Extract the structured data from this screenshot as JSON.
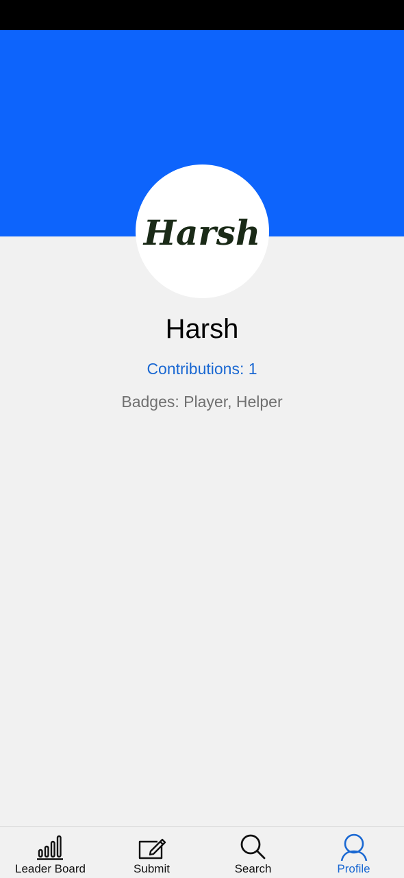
{
  "profile": {
    "avatar_text": "Harsh",
    "name": "Harsh",
    "contributions_label": "Contributions:",
    "contributions_count": "1",
    "badges_text": "Badges: Player, Helper"
  },
  "bottom_nav": {
    "items": [
      {
        "label": "Leader Board",
        "icon": "leaderboard-icon"
      },
      {
        "label": "Submit",
        "icon": "edit-icon"
      },
      {
        "label": "Search",
        "icon": "search-icon"
      },
      {
        "label": "Profile",
        "icon": "user-icon"
      }
    ],
    "active_index": 3
  },
  "colors": {
    "header": "#0d64fc",
    "accent": "#1a68d2",
    "background": "#f1f1f1",
    "status_bar": "#000000"
  }
}
